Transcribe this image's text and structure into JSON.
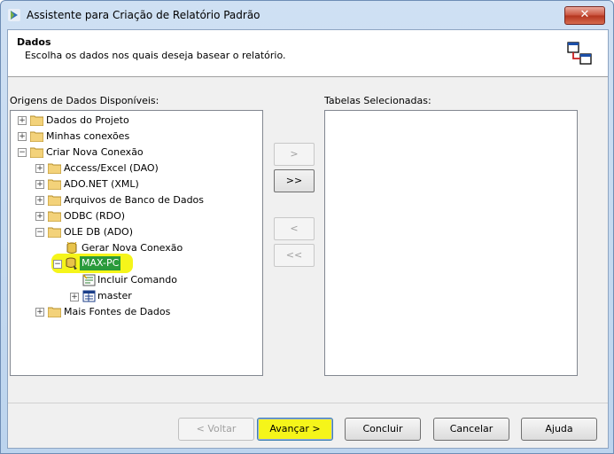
{
  "window": {
    "title": "Assistente para Criação de Relatório Padrão",
    "close_glyph": "✕"
  },
  "header": {
    "title": "Dados",
    "description": "Escolha os dados nos quais deseja basear o relatório."
  },
  "left_panel": {
    "label": "Origens de Dados Disponíveis:"
  },
  "right_panel": {
    "label": "Tabelas Selecionadas:"
  },
  "tree": {
    "items": [
      {
        "label": "Dados do Projeto",
        "expander": "+"
      },
      {
        "label": "Minhas conexões",
        "expander": "+"
      },
      {
        "label": "Criar Nova Conexão",
        "expander": "−"
      },
      {
        "label": "Access/Excel (DAO)",
        "expander": "+"
      },
      {
        "label": "ADO.NET (XML)",
        "expander": "+"
      },
      {
        "label": "Arquivos de Banco de Dados",
        "expander": "+"
      },
      {
        "label": "ODBC (RDO)",
        "expander": "+"
      },
      {
        "label": "OLE DB (ADO)",
        "expander": "−"
      },
      {
        "label": "Gerar Nova Conexão",
        "expander": ""
      },
      {
        "label": "MAX-PC",
        "expander": "−",
        "selected": true
      },
      {
        "label": "Incluir Comando",
        "expander": ""
      },
      {
        "label": "master",
        "expander": "+"
      },
      {
        "label": "Mais Fontes de Dados",
        "expander": "+"
      }
    ]
  },
  "move_buttons": {
    "add_one": ">",
    "add_all": ">>",
    "remove_one": "<",
    "remove_all": "<<"
  },
  "footer": {
    "back": "< Voltar",
    "next": "Avançar >",
    "finish": "Concluir",
    "cancel": "Cancelar",
    "help": "Ajuda"
  },
  "colors": {
    "highlight": "#f5f51a",
    "selection": "#2a9a3a"
  }
}
